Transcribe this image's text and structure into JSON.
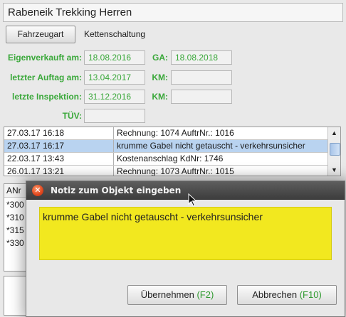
{
  "title": "Rabeneik Trekking Herren",
  "fahrzeugart": {
    "button_label": "Fahrzeugart",
    "value": "Kettenschaltung"
  },
  "fields": {
    "eigenverkauft": {
      "label": "Eigenverkauft am:",
      "value": "18.08.2016"
    },
    "ga": {
      "label": "GA:",
      "value": "18.08.2018"
    },
    "letzter_auftrag": {
      "label": "letzter Auftag am:",
      "value": "13.04.2017"
    },
    "km1": {
      "label": "KM:",
      "value": ""
    },
    "letzte_inspektion": {
      "label": "letzte Inspektion:",
      "value": "31.12.2016"
    },
    "km2": {
      "label": "KM:",
      "value": ""
    },
    "tuev": {
      "label": "TÜV:",
      "value": ""
    }
  },
  "history": [
    {
      "date": "27.03.17 16:18",
      "text": "Rechnung: 1074 AuftrNr.: 1016",
      "selected": false
    },
    {
      "date": "27.03.17 16:17",
      "text": "krumme Gabel nicht getauscht - verkehrsunsicher",
      "selected": true
    },
    {
      "date": "22.03.17 13:43",
      "text": "Kostenanschlag KdNr: 1746",
      "selected": false
    },
    {
      "date": "26.01.17 13:21",
      "text": "Rechnung: 1073 AuftrNr.: 1015",
      "selected": false
    }
  ],
  "lower_table": {
    "header": "ANr",
    "rows": [
      "*300",
      "*310",
      "*315",
      "*330"
    ]
  },
  "dialog": {
    "title": "Notiz zum Objekt eingeben",
    "note": "krumme Gabel nicht getauscht - verkehrsunsicher",
    "ok_label": "Übernehmen",
    "ok_key": "(F2)",
    "cancel_label": "Abbrechen",
    "cancel_key": "(F10)"
  },
  "colors": {
    "label_green": "#3aa83a",
    "note_yellow": "#f2e81f",
    "selection_blue": "#b9d3f0"
  }
}
